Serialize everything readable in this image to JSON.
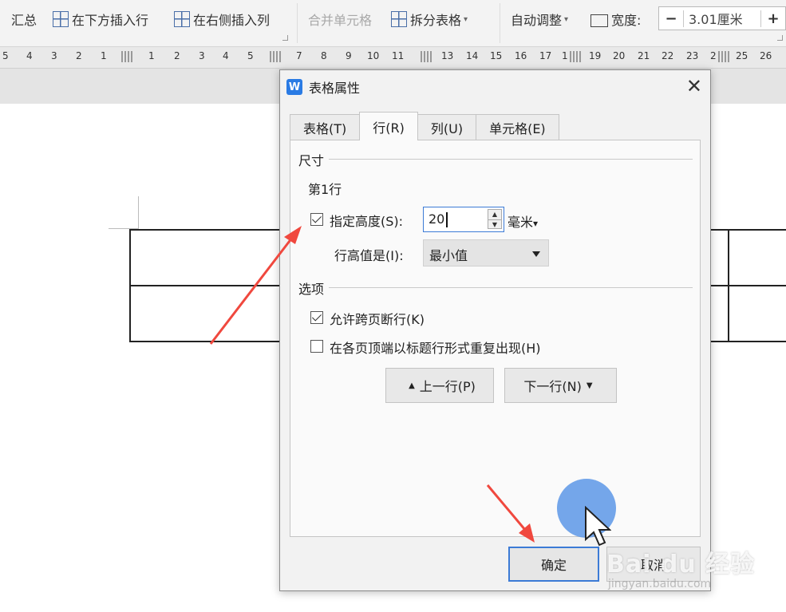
{
  "ribbon": {
    "summary": "汇总",
    "insert_row_below": "在下方插入行",
    "insert_col_right": "在右侧插入列",
    "merge_cells": "合并单元格",
    "split_table": "拆分表格",
    "auto_fit": "自动调整",
    "width_label": "宽度:",
    "width_minus": "−",
    "width_value": "3.01厘米",
    "width_plus": "+"
  },
  "ruler": {
    "ticks": [
      "5",
      "4",
      "3",
      "2",
      "1",
      "1",
      "2",
      "3",
      "4",
      "5",
      "7",
      "8",
      "9",
      "10",
      "11",
      "13",
      "14",
      "15",
      "16",
      "17",
      "1",
      "19",
      "20",
      "21",
      "22",
      "23",
      "2",
      "25",
      "26"
    ]
  },
  "dialog": {
    "app_icon": "W",
    "title": "表格属性",
    "close": "✕",
    "tabs": [
      "表格(T)",
      "行(R)",
      "列(U)",
      "单元格(E)"
    ],
    "size_group": "尺寸",
    "row_label": "第1行",
    "specify_height_label": "指定高度(S):",
    "height_value": "20",
    "unit_value": "毫米",
    "unit_caret": "▾",
    "row_height_is_label": "行高值是(I):",
    "row_height_is_value": "最小值",
    "options_group": "选项",
    "allow_break_label": "允许跨页断行(K)",
    "repeat_header_label": "在各页顶端以标题行形式重复出现(H)",
    "prev_row": "上一行(P)",
    "next_row": "下一行(N)",
    "prev_glyph": "▲",
    "next_glyph": "▼",
    "ok": "确定",
    "cancel": "取消"
  },
  "watermark": {
    "main": "Bai du 经验",
    "sub": "jingyan.baidu.com"
  },
  "colors": {
    "accent": "#3c7bd6",
    "arrow": "#f0483e",
    "dialog_bg": "#f2f2f2"
  },
  "icons": {
    "insert_row_below": "table-insert-row-icon",
    "insert_col_right": "table-insert-col-icon",
    "split_table": "split-table-icon",
    "width": "width-icon",
    "mouse": "mouse-cursor-icon"
  }
}
